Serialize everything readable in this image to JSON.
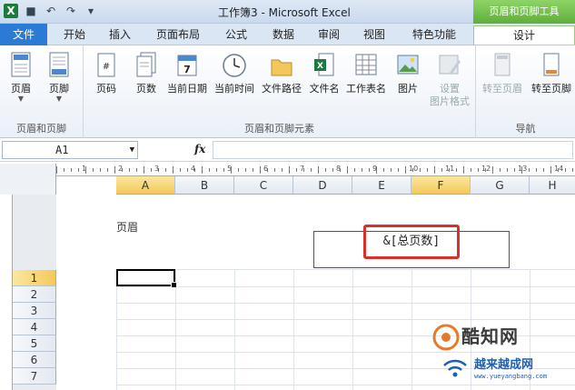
{
  "window": {
    "title": "工作簿3 - Microsoft Excel",
    "context_tab_group": "页眉和页脚工具"
  },
  "tabs": [
    "文件",
    "开始",
    "插入",
    "页面布局",
    "公式",
    "数据",
    "审阅",
    "视图",
    "特色功能",
    "设计"
  ],
  "ribbon": {
    "groups": [
      {
        "label": "页眉和页脚",
        "buttons": [
          {
            "label": "页眉",
            "icon": "header-icon"
          },
          {
            "label": "页脚",
            "icon": "footer-icon"
          }
        ]
      },
      {
        "label": "页眉和页脚元素",
        "buttons": [
          {
            "label": "页码",
            "icon": "page-number-icon"
          },
          {
            "label": "页数",
            "icon": "page-count-icon"
          },
          {
            "label": "当前日期",
            "icon": "calendar-icon"
          },
          {
            "label": "当前时间",
            "icon": "clock-icon"
          },
          {
            "label": "文件路径",
            "icon": "folder-icon"
          },
          {
            "label": "文件名",
            "icon": "excel-file-icon"
          },
          {
            "label": "工作表名",
            "icon": "sheet-icon"
          },
          {
            "label": "图片",
            "icon": "picture-icon"
          },
          {
            "label": "设置\n图片格式",
            "icon": "format-picture-icon",
            "disabled": true
          }
        ]
      },
      {
        "label": "导航",
        "buttons": [
          {
            "label": "转至页眉",
            "icon": "goto-header-icon",
            "disabled": true
          },
          {
            "label": "转至页脚",
            "icon": "goto-footer-icon"
          }
        ]
      }
    ]
  },
  "formula_bar": {
    "name_box": "A1",
    "fx": "fx",
    "formula": ""
  },
  "columns": [
    "A",
    "B",
    "C",
    "D",
    "E",
    "F",
    "G",
    "H"
  ],
  "rows": [
    "1",
    "2",
    "3",
    "4",
    "5",
    "6",
    "7"
  ],
  "ruler_numbers": [
    "1",
    "2",
    "3",
    "4",
    "5",
    "6",
    "7",
    "8",
    "9",
    "10",
    "11",
    "12",
    "13",
    "14"
  ],
  "page": {
    "header_caption": "页眉",
    "header_field": "&[总页数]"
  },
  "watermark": {
    "title": "酷知网",
    "subtitle": "越来越成网",
    "url": "www.yueyangbang.com"
  },
  "colors": {
    "accent": "#2b7bd4",
    "context": "#5fae3a",
    "highlight_box": "#d8312c",
    "selected_header": "#f4c95a"
  }
}
